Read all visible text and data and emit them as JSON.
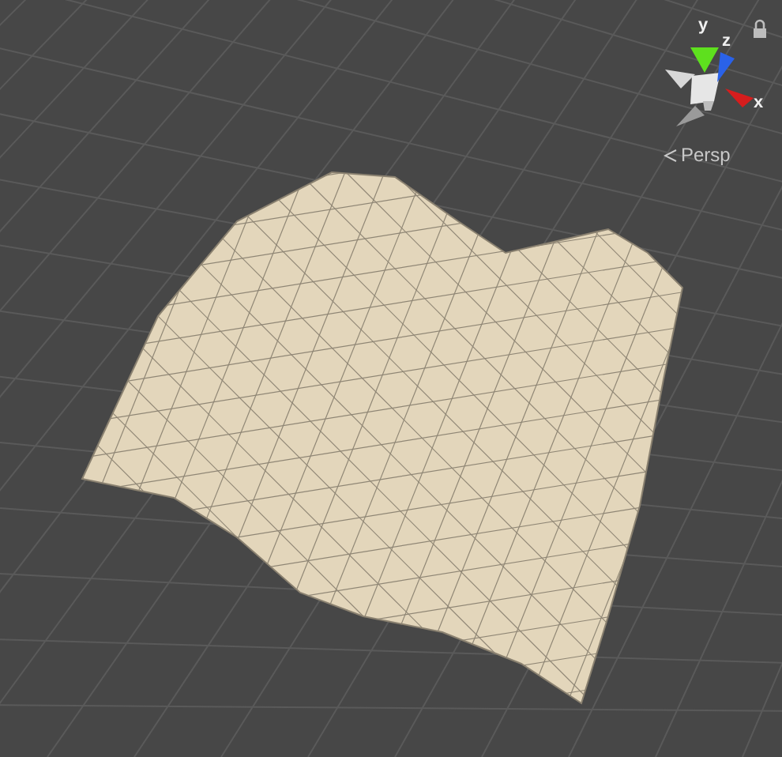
{
  "gizmo": {
    "axes": [
      {
        "label": "y",
        "color": "#5ee01e"
      },
      {
        "label": "z",
        "color": "#2a62e8"
      },
      {
        "label": "x",
        "color": "#d61d1d"
      }
    ]
  },
  "projection_button": {
    "label": "Persp"
  }
}
